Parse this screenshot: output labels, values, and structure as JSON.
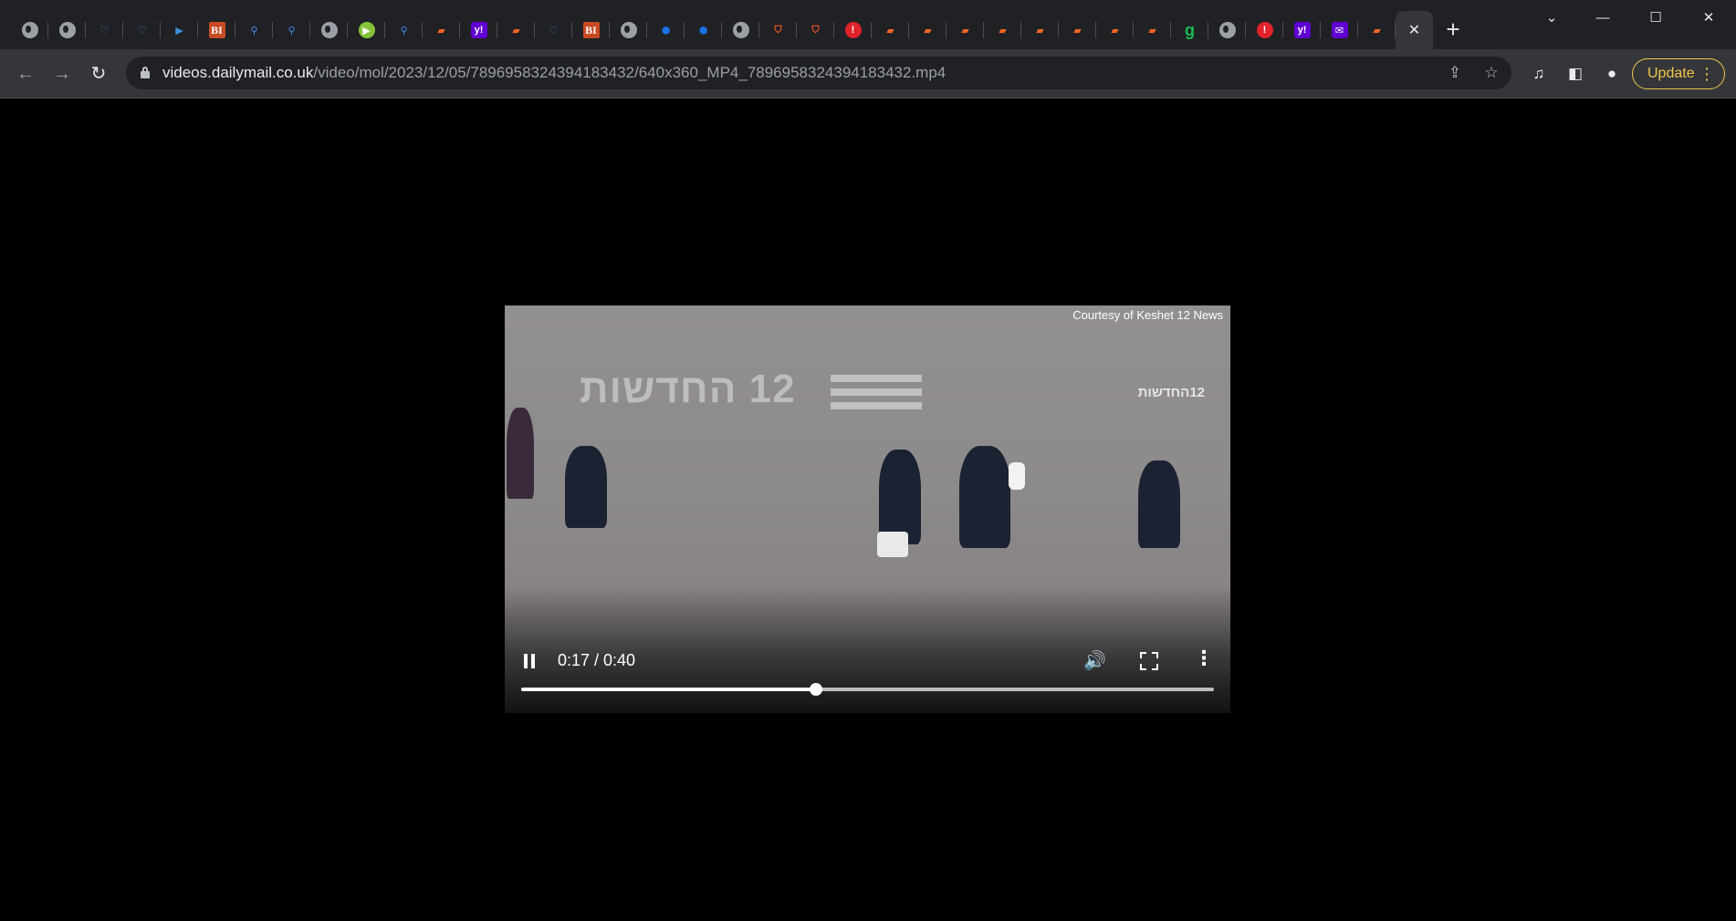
{
  "tabs": [
    {
      "icon": "globe-icon",
      "kind": "globe",
      "glyph": ""
    },
    {
      "icon": "globe-icon",
      "kind": "globe",
      "glyph": ""
    },
    {
      "icon": "malwarebytes-icon",
      "kind": "mb",
      "glyph": "♡"
    },
    {
      "icon": "malwarebytes-icon",
      "kind": "mb",
      "glyph": "♡"
    },
    {
      "icon": "tag-icon",
      "kind": "mb",
      "glyph": "▶"
    },
    {
      "icon": "business-insider-icon",
      "kind": "bi",
      "glyph": "BI"
    },
    {
      "icon": "search-icon",
      "kind": "search",
      "glyph": "⚲"
    },
    {
      "icon": "search-icon",
      "kind": "search",
      "glyph": "⚲"
    },
    {
      "icon": "globe-icon",
      "kind": "globe",
      "glyph": ""
    },
    {
      "icon": "play-icon",
      "kind": "play",
      "glyph": "▶"
    },
    {
      "icon": "search-icon",
      "kind": "search",
      "glyph": "⚲"
    },
    {
      "icon": "bookmark-icon",
      "kind": "bookmark",
      "glyph": "▰"
    },
    {
      "icon": "yahoo-icon",
      "kind": "yahoo",
      "glyph": "y!"
    },
    {
      "icon": "bookmark-icon",
      "kind": "bookmark",
      "glyph": "▰"
    },
    {
      "icon": "malwarebytes-icon",
      "kind": "mb",
      "glyph": "♡"
    },
    {
      "icon": "business-insider-icon",
      "kind": "bi",
      "glyph": "BI"
    },
    {
      "icon": "globe-icon",
      "kind": "globe",
      "glyph": ""
    },
    {
      "icon": "cube-icon",
      "kind": "cube",
      "glyph": "⬢"
    },
    {
      "icon": "cube-icon",
      "kind": "cube",
      "glyph": "⬢"
    },
    {
      "icon": "globe-icon",
      "kind": "globe",
      "glyph": ""
    },
    {
      "icon": "shield-icon",
      "kind": "shield",
      "glyph": "⛉"
    },
    {
      "icon": "shield-icon",
      "kind": "shield",
      "glyph": "⛉"
    },
    {
      "icon": "map-pin-icon",
      "kind": "pin",
      "glyph": "!"
    },
    {
      "icon": "bookmark-icon",
      "kind": "bookmark",
      "glyph": "▰"
    },
    {
      "icon": "bookmark-icon",
      "kind": "bookmark",
      "glyph": "▰"
    },
    {
      "icon": "bookmark-icon",
      "kind": "bookmark",
      "glyph": "▰"
    },
    {
      "icon": "bookmark-icon",
      "kind": "bookmark",
      "glyph": "▰"
    },
    {
      "icon": "bookmark-icon",
      "kind": "bookmark",
      "glyph": "▰"
    },
    {
      "icon": "bookmark-icon",
      "kind": "bookmark",
      "glyph": "▰"
    },
    {
      "icon": "bookmark-icon",
      "kind": "bookmark",
      "glyph": "▰"
    },
    {
      "icon": "bookmark-icon",
      "kind": "bookmark",
      "glyph": "▰"
    },
    {
      "icon": "grammarly-icon",
      "kind": "g",
      "glyph": "g"
    },
    {
      "icon": "globe-icon",
      "kind": "globe",
      "glyph": ""
    },
    {
      "icon": "map-pin-icon",
      "kind": "pin",
      "glyph": "!"
    },
    {
      "icon": "yahoo-icon",
      "kind": "yahoo",
      "glyph": "y!"
    },
    {
      "icon": "yahoo-mail-icon",
      "kind": "mail",
      "glyph": "✉"
    },
    {
      "icon": "bookmark-icon",
      "kind": "bookmark",
      "glyph": "▰"
    }
  ],
  "active_tab_close": "✕",
  "new_tab": "+",
  "window": {
    "chevron": "⌄",
    "minimize": "—",
    "maximize": "☐",
    "close": "✕"
  },
  "toolbar": {
    "back": "←",
    "forward": "→",
    "reload": "↻",
    "url_host": "videos.dailymail.co.uk",
    "url_path": "/video/mol/2023/12/05/7896958324394183432/640x360_MP4_7896958324394183432.mp4",
    "share": "⇪",
    "star": "☆",
    "media": "♫",
    "sidepanel": "◧",
    "profile": "●",
    "update_label": "Update",
    "menu": "⋮"
  },
  "video": {
    "courtesy": "Courtesy of Keshet 12 News",
    "watermark_big": "12 החדשות",
    "watermark_small": "12החדשות",
    "time": "0:17 / 0:40",
    "volume": "🔊",
    "more": "⋮",
    "progress_fraction": 0.425
  },
  "colors": {
    "bookmark": "#f26522",
    "cube": "#1a73e8",
    "mb": "#3a8fd6",
    "search": "#4c8bf5",
    "shield": "#ff5722"
  }
}
